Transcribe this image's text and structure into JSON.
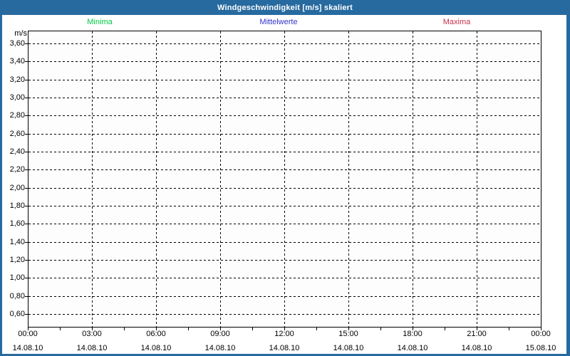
{
  "window": {
    "title": "Windgeschwindigkeit [m/s] skaliert"
  },
  "colors": {
    "titlebar": "#276a9f",
    "window_border": "#276a9f",
    "title_text": "#ffffff",
    "axis": "#000000",
    "grid": "#000000",
    "background": "#ffffff",
    "plot_background": "#fdfdfd",
    "minima": "#00c845",
    "mittelwerte": "#3333cc",
    "maxima": "#c8324b"
  },
  "chart_data": {
    "type": "line",
    "title": "Windgeschwindigkeit [m/s] skaliert",
    "ylabel": "m/s",
    "xlabel": "",
    "legend_position": "top",
    "grid": "dashed both axes",
    "series": [
      {
        "name": "Minima",
        "color": "#00c845",
        "values": []
      },
      {
        "name": "Mittelwerte",
        "color": "#3333cc",
        "values": []
      },
      {
        "name": "Maxima",
        "color": "#c8324b",
        "values": []
      }
    ],
    "no_data_plotted": true,
    "y_ticks": [
      "3,60",
      "3,40",
      "3,20",
      "3,00",
      "2,80",
      "2,60",
      "2,40",
      "2,20",
      "2,00",
      "1,80",
      "1,60",
      "1,40",
      "1,20",
      "1,00",
      "0,80",
      "0,60"
    ],
    "y_tick_values": [
      3.6,
      3.4,
      3.2,
      3.0,
      2.8,
      2.6,
      2.4,
      2.2,
      2.0,
      1.8,
      1.6,
      1.4,
      1.2,
      1.0,
      0.8,
      0.6
    ],
    "ylim": [
      0.47,
      3.74
    ],
    "x_ticks": [
      {
        "time": "00:00",
        "date": "14.08.10"
      },
      {
        "time": "03:00",
        "date": "14.08.10"
      },
      {
        "time": "06:00",
        "date": "14.08.10"
      },
      {
        "time": "09:00",
        "date": "14.08.10"
      },
      {
        "time": "12:00",
        "date": "14.08.10"
      },
      {
        "time": "15:00",
        "date": "14.08.10"
      },
      {
        "time": "18:00",
        "date": "14.08.10"
      },
      {
        "time": "21:00",
        "date": "14.08.10"
      },
      {
        "time": "00:00",
        "date": "15.08.10"
      }
    ],
    "x_minor_ticks_between_majors": 1
  }
}
